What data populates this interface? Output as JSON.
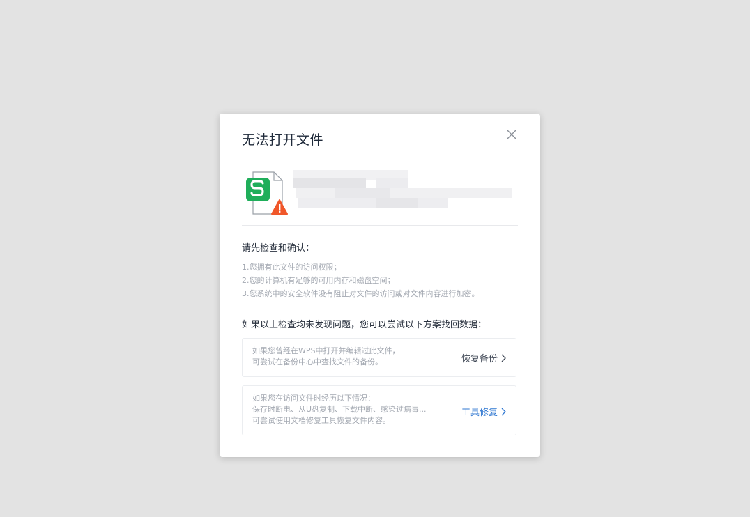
{
  "dialog": {
    "title": "无法打开文件",
    "close_icon": "close-icon",
    "file_icon": "wps-spreadsheet-warning-icon",
    "colors": {
      "backdrop": "#e3e3e3",
      "icon_green": "#1fae5a",
      "warning_orange": "#f0572a",
      "link_blue": "#2f77d1"
    }
  },
  "check": {
    "heading": "请先检查和确认：",
    "items": [
      "1.您拥有此文件的访问权限；",
      "2.您的计算机有足够的可用内存和磁盘空间；",
      "3.您系统中的安全软件没有阻止对文件的访问或对文件内容进行加密。"
    ]
  },
  "solutions": {
    "heading": "如果以上检查均未发现问题，您可以尝试以下方案找回数据：",
    "backup": {
      "lines": [
        "如果您曾经在WPS中打开并编辑过此文件，",
        "可尝试在备份中心中查找文件的备份。"
      ],
      "action": "恢复备份"
    },
    "repair": {
      "lines": [
        "如果您在访问文件时经历以下情况：",
        "保存时断电、从U盘复制、下载中断、感染过病毒...",
        "可尝试使用文档修复工具恢复文件内容。"
      ],
      "action": "工具修复"
    }
  }
}
